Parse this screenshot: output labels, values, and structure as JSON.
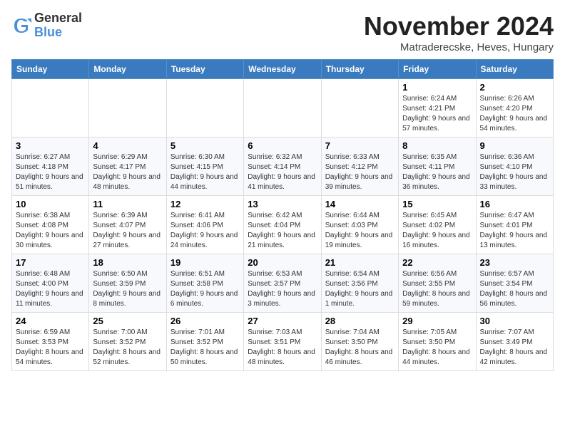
{
  "header": {
    "logo_line1": "General",
    "logo_line2": "Blue",
    "month_title": "November 2024",
    "location": "Matraderecske, Heves, Hungary"
  },
  "weekdays": [
    "Sunday",
    "Monday",
    "Tuesday",
    "Wednesday",
    "Thursday",
    "Friday",
    "Saturday"
  ],
  "weeks": [
    [
      {
        "day": "",
        "info": ""
      },
      {
        "day": "",
        "info": ""
      },
      {
        "day": "",
        "info": ""
      },
      {
        "day": "",
        "info": ""
      },
      {
        "day": "",
        "info": ""
      },
      {
        "day": "1",
        "info": "Sunrise: 6:24 AM\nSunset: 4:21 PM\nDaylight: 9 hours and 57 minutes."
      },
      {
        "day": "2",
        "info": "Sunrise: 6:26 AM\nSunset: 4:20 PM\nDaylight: 9 hours and 54 minutes."
      }
    ],
    [
      {
        "day": "3",
        "info": "Sunrise: 6:27 AM\nSunset: 4:18 PM\nDaylight: 9 hours and 51 minutes."
      },
      {
        "day": "4",
        "info": "Sunrise: 6:29 AM\nSunset: 4:17 PM\nDaylight: 9 hours and 48 minutes."
      },
      {
        "day": "5",
        "info": "Sunrise: 6:30 AM\nSunset: 4:15 PM\nDaylight: 9 hours and 44 minutes."
      },
      {
        "day": "6",
        "info": "Sunrise: 6:32 AM\nSunset: 4:14 PM\nDaylight: 9 hours and 41 minutes."
      },
      {
        "day": "7",
        "info": "Sunrise: 6:33 AM\nSunset: 4:12 PM\nDaylight: 9 hours and 39 minutes."
      },
      {
        "day": "8",
        "info": "Sunrise: 6:35 AM\nSunset: 4:11 PM\nDaylight: 9 hours and 36 minutes."
      },
      {
        "day": "9",
        "info": "Sunrise: 6:36 AM\nSunset: 4:10 PM\nDaylight: 9 hours and 33 minutes."
      }
    ],
    [
      {
        "day": "10",
        "info": "Sunrise: 6:38 AM\nSunset: 4:08 PM\nDaylight: 9 hours and 30 minutes."
      },
      {
        "day": "11",
        "info": "Sunrise: 6:39 AM\nSunset: 4:07 PM\nDaylight: 9 hours and 27 minutes."
      },
      {
        "day": "12",
        "info": "Sunrise: 6:41 AM\nSunset: 4:06 PM\nDaylight: 9 hours and 24 minutes."
      },
      {
        "day": "13",
        "info": "Sunrise: 6:42 AM\nSunset: 4:04 PM\nDaylight: 9 hours and 21 minutes."
      },
      {
        "day": "14",
        "info": "Sunrise: 6:44 AM\nSunset: 4:03 PM\nDaylight: 9 hours and 19 minutes."
      },
      {
        "day": "15",
        "info": "Sunrise: 6:45 AM\nSunset: 4:02 PM\nDaylight: 9 hours and 16 minutes."
      },
      {
        "day": "16",
        "info": "Sunrise: 6:47 AM\nSunset: 4:01 PM\nDaylight: 9 hours and 13 minutes."
      }
    ],
    [
      {
        "day": "17",
        "info": "Sunrise: 6:48 AM\nSunset: 4:00 PM\nDaylight: 9 hours and 11 minutes."
      },
      {
        "day": "18",
        "info": "Sunrise: 6:50 AM\nSunset: 3:59 PM\nDaylight: 9 hours and 8 minutes."
      },
      {
        "day": "19",
        "info": "Sunrise: 6:51 AM\nSunset: 3:58 PM\nDaylight: 9 hours and 6 minutes."
      },
      {
        "day": "20",
        "info": "Sunrise: 6:53 AM\nSunset: 3:57 PM\nDaylight: 9 hours and 3 minutes."
      },
      {
        "day": "21",
        "info": "Sunrise: 6:54 AM\nSunset: 3:56 PM\nDaylight: 9 hours and 1 minute."
      },
      {
        "day": "22",
        "info": "Sunrise: 6:56 AM\nSunset: 3:55 PM\nDaylight: 8 hours and 59 minutes."
      },
      {
        "day": "23",
        "info": "Sunrise: 6:57 AM\nSunset: 3:54 PM\nDaylight: 8 hours and 56 minutes."
      }
    ],
    [
      {
        "day": "24",
        "info": "Sunrise: 6:59 AM\nSunset: 3:53 PM\nDaylight: 8 hours and 54 minutes."
      },
      {
        "day": "25",
        "info": "Sunrise: 7:00 AM\nSunset: 3:52 PM\nDaylight: 8 hours and 52 minutes."
      },
      {
        "day": "26",
        "info": "Sunrise: 7:01 AM\nSunset: 3:52 PM\nDaylight: 8 hours and 50 minutes."
      },
      {
        "day": "27",
        "info": "Sunrise: 7:03 AM\nSunset: 3:51 PM\nDaylight: 8 hours and 48 minutes."
      },
      {
        "day": "28",
        "info": "Sunrise: 7:04 AM\nSunset: 3:50 PM\nDaylight: 8 hours and 46 minutes."
      },
      {
        "day": "29",
        "info": "Sunrise: 7:05 AM\nSunset: 3:50 PM\nDaylight: 8 hours and 44 minutes."
      },
      {
        "day": "30",
        "info": "Sunrise: 7:07 AM\nSunset: 3:49 PM\nDaylight: 8 hours and 42 minutes."
      }
    ]
  ]
}
